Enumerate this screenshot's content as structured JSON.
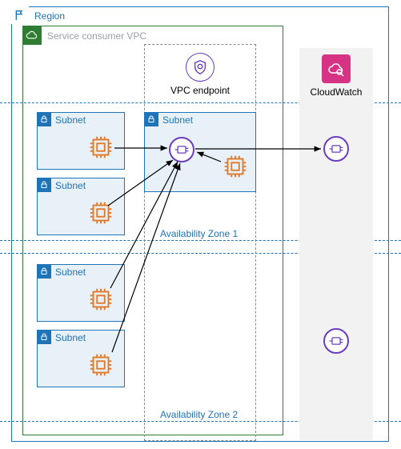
{
  "region": {
    "label": "Region"
  },
  "vpc": {
    "label": "Service consumer VPC"
  },
  "endpoint": {
    "label": "VPC endpoint"
  },
  "cloudwatch": {
    "label": "CloudWatch"
  },
  "az": {
    "zone1": "Availability Zone 1",
    "zone2": "Availability Zone 2"
  },
  "subnets": {
    "left": [
      {
        "label": "Subnet"
      },
      {
        "label": "Subnet"
      },
      {
        "label": "Subnet"
      },
      {
        "label": "Subnet"
      }
    ],
    "endpoint_subnet": {
      "label": "Subnet"
    }
  },
  "arrows": [
    {
      "from": "left-subnet-1-cpu",
      "to": "endpoint-eni"
    },
    {
      "from": "left-subnet-2-cpu",
      "to": "endpoint-eni"
    },
    {
      "from": "left-subnet-3-cpu",
      "to": "endpoint-eni"
    },
    {
      "from": "left-subnet-4-cpu",
      "to": "endpoint-eni"
    },
    {
      "from": "endpoint-subnet-cpu",
      "to": "endpoint-eni"
    },
    {
      "from": "endpoint-eni",
      "to": "cloudwatch-eni-1"
    }
  ]
}
